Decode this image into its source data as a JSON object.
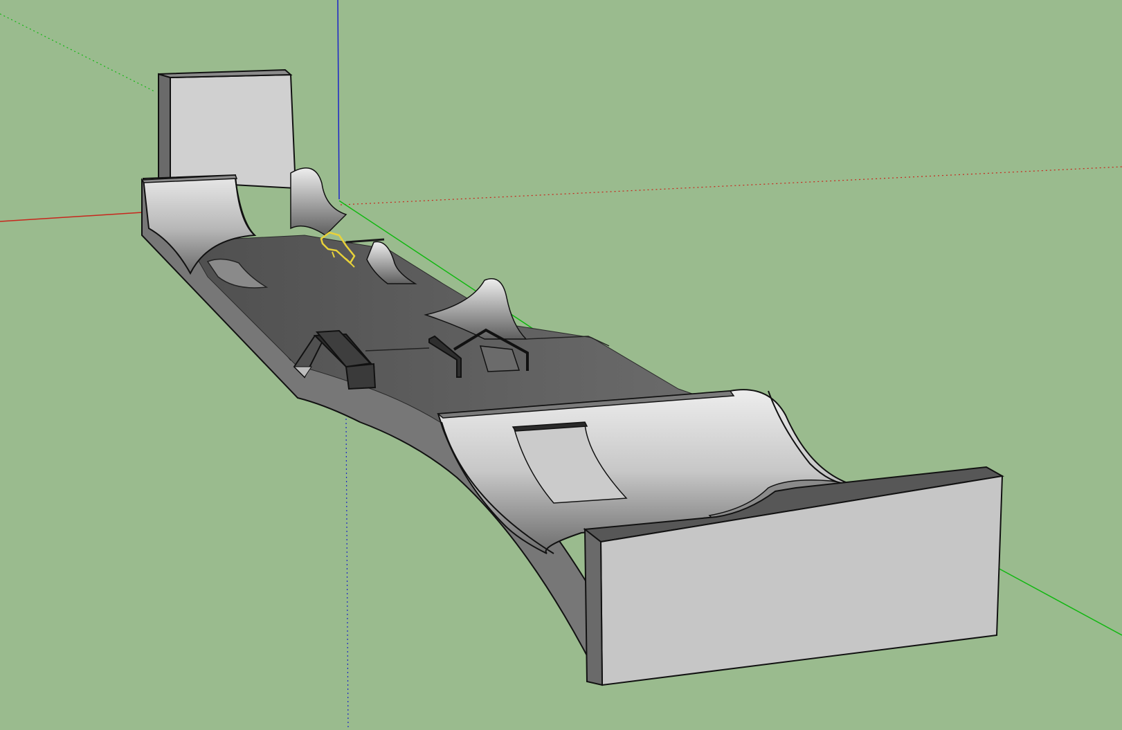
{
  "viewport": {
    "background_color": "#9abb8e",
    "view": "perspective"
  },
  "axes": {
    "red_axis_color": "#c8251c",
    "green_axis_color": "#11b811",
    "blue_axis_color": "#1a23c8"
  },
  "model": {
    "name": "skatepark",
    "components": [
      "box-wall",
      "quarter-pipe",
      "spine-hump",
      "funbox",
      "grind-rail",
      "kink-rail",
      "ramp-bank",
      "low-box",
      "end-wall-block"
    ],
    "face_colors": {
      "light": "#c8c8c8",
      "mid": "#9a9a9a",
      "dark": "#5f5f5f",
      "deck": "#646464",
      "edge": "#1a1a1a"
    },
    "selection_color": "#e8d23a"
  }
}
